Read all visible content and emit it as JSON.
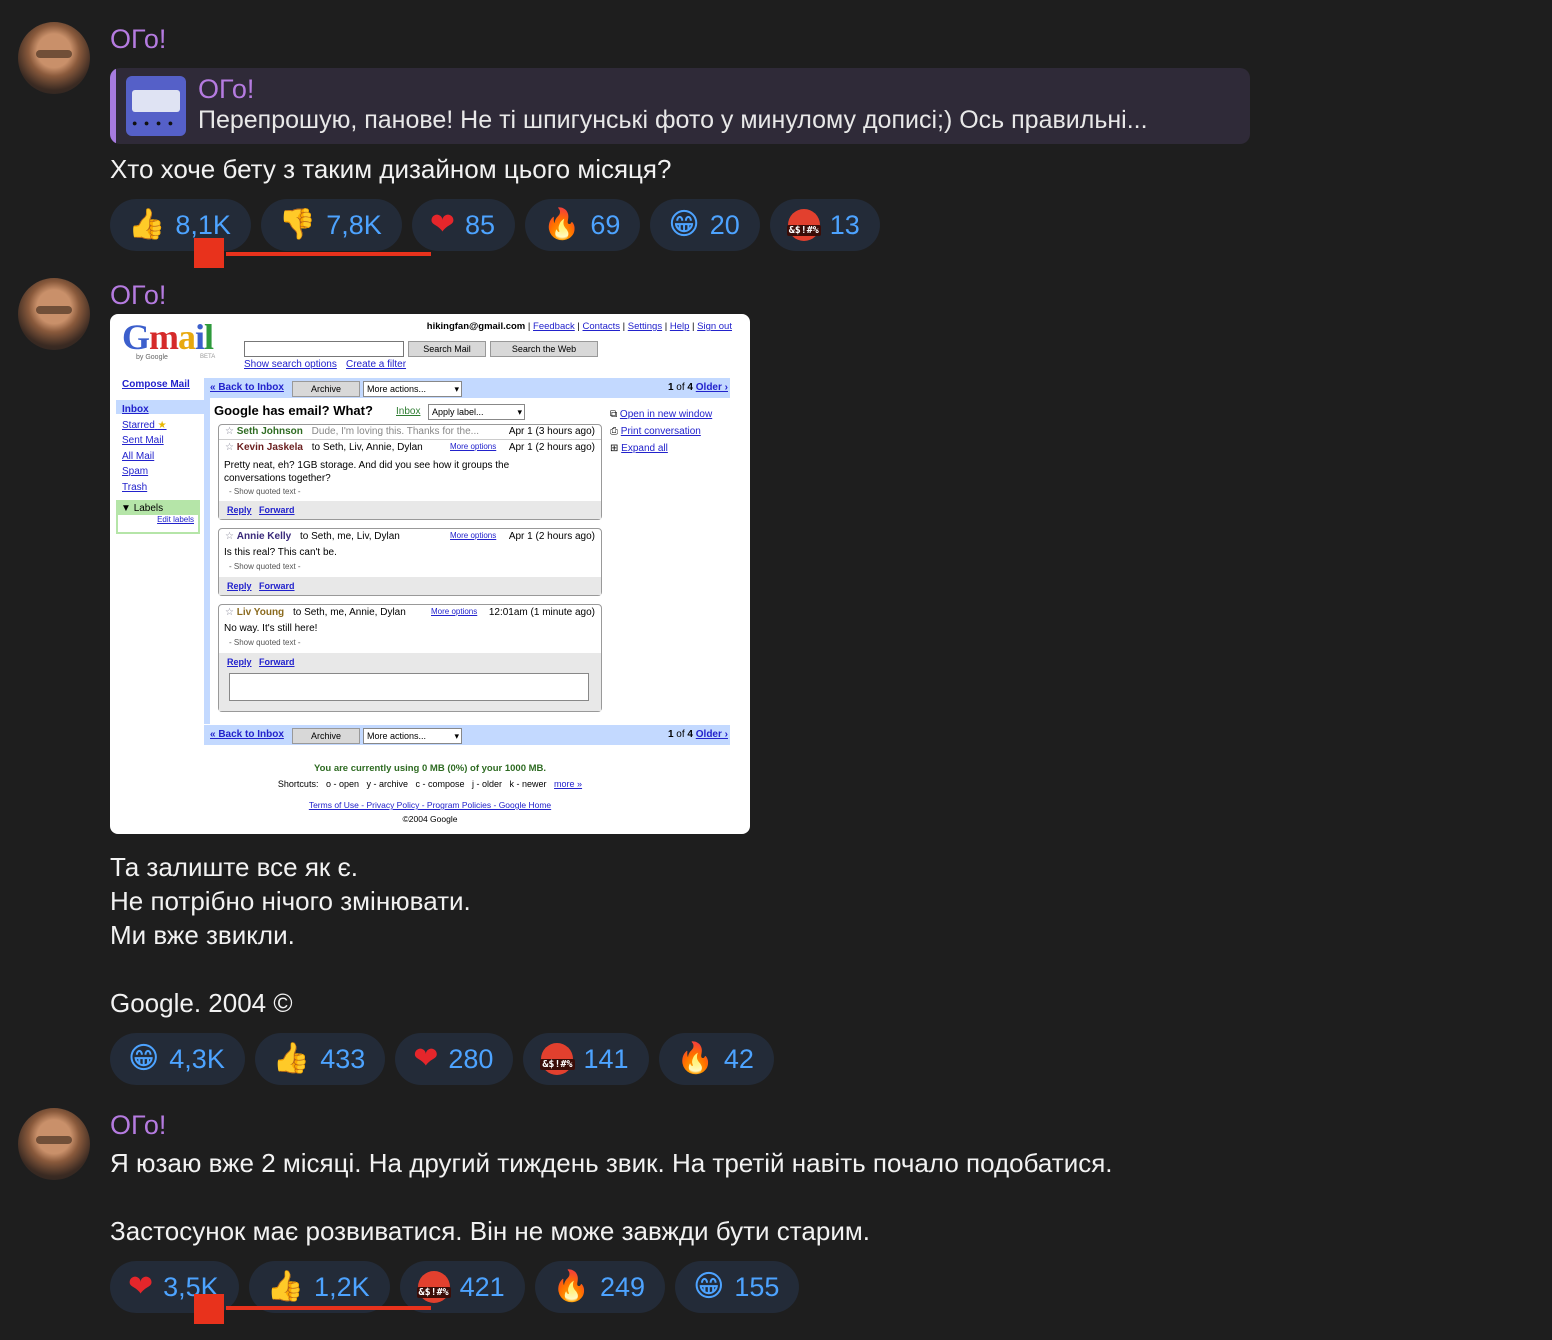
{
  "channel_name": "ОГо!",
  "messages": [
    {
      "author": "ОГо!",
      "reply": {
        "author": "ОГо!",
        "text": "Перепрошую, панове! Не ті шпигунські фото у минулому дописі;) Ось правильні..."
      },
      "text": "Хто хоче бету з таким дизайном цього місяця?",
      "reactions": [
        {
          "emoji": "👍",
          "count": "8,1K"
        },
        {
          "emoji": "👎",
          "count": "7,8K"
        },
        {
          "emoji": "❤",
          "count": "85"
        },
        {
          "emoji": "🔥",
          "count": "69"
        },
        {
          "emoji": "😁",
          "count": "20"
        },
        {
          "emoji": "🤬",
          "emoji_text": "&$!#%",
          "count": "13"
        }
      ]
    },
    {
      "author": "ОГо!",
      "image": {
        "logo": "Gmail",
        "by_google": "by Google",
        "beta": "BETA",
        "account": "hikingfan@gmail.com",
        "top_links": [
          "Feedback",
          "Contacts",
          "Settings",
          "Help",
          "Sign out"
        ],
        "search_mail": "Search Mail",
        "search_web": "Search the Web",
        "show_search_options": "Show search options",
        "create_filter": "Create a filter",
        "compose": "Compose Mail",
        "nav": [
          "Inbox",
          "Starred",
          "Sent Mail",
          "All Mail",
          "Spam",
          "Trash"
        ],
        "labels": "Labels",
        "edit_labels": "Edit labels",
        "back_to_inbox": "« Back to Inbox",
        "archive": "Archive",
        "more_actions": "More actions...",
        "pager_prefix": "1",
        "pager_of": "of",
        "pager_total": "4",
        "older": "Older ›",
        "subject": "Google has email? What?",
        "inbox_label": "Inbox",
        "apply_label": "Apply label...",
        "side_actions": [
          "Open in new window",
          "Print conversation",
          "Expand all"
        ],
        "emails": [
          {
            "from": "Seth Johnson",
            "snippet": "Dude, I'm loving this. Thanks for the...",
            "date": "Apr 1 (3 hours ago)"
          },
          {
            "from": "Kevin Jaskela",
            "to": "to Seth, Liv, Annie, Dylan",
            "more": "More options",
            "date": "Apr 1 (2 hours ago)",
            "body": "Pretty neat, eh? 1GB storage. And did you see how it groups the conversations together?",
            "quoted": "- Show quoted text -"
          },
          {
            "from": "Annie Kelly",
            "to": "to Seth, me, Liv, Dylan",
            "more": "More options",
            "date": "Apr 1 (2 hours ago)",
            "body": "Is this real? This can't be.",
            "quoted": "- Show quoted text -"
          },
          {
            "from": "Liv Young",
            "to": "to Seth, me, Annie, Dylan",
            "more": "More options",
            "date": "12:01am (1 minute ago)",
            "body": "No way. It's still here!",
            "quoted": "- Show quoted text -"
          }
        ],
        "reply": "Reply",
        "forward": "Forward",
        "usage": "You are currently using 0 MB (0%) of your 1000 MB.",
        "shortcuts": "Shortcuts:   o - open   y - archive   c - compose   j - older   k - newer",
        "more_link": "more »",
        "footer_links": "Terms of Use - Privacy Policy - Program Policies - Google Home",
        "copyright": "©2004 Google"
      },
      "text": "Та залиште все як є.\nНе потрібно нічого змінювати.\nМи вже звикли.\n\nGoogle. 2004 ©",
      "reactions": [
        {
          "emoji": "😁",
          "count": "4,3K"
        },
        {
          "emoji": "👍",
          "count": "433"
        },
        {
          "emoji": "❤",
          "count": "280"
        },
        {
          "emoji": "🤬",
          "emoji_text": "&$!#%",
          "count": "141"
        },
        {
          "emoji": "🔥",
          "count": "42"
        }
      ]
    },
    {
      "author": "ОГо!",
      "text": "Я юзаю вже 2 місяці. На другий тиждень звик. На третій навіть почало подобатися.\n\nЗастосунок має розвиватися. Він не може завжди бути старим.",
      "reactions": [
        {
          "emoji": "❤",
          "count": "3,5K"
        },
        {
          "emoji": "👍",
          "count": "1,2K"
        },
        {
          "emoji": "🤬",
          "emoji_text": "&$!#%",
          "count": "421"
        },
        {
          "emoji": "🔥",
          "count": "249"
        },
        {
          "emoji": "😁",
          "count": "155"
        }
      ]
    }
  ],
  "colors": {
    "background": "#1e1e1e",
    "author": "#b57be0",
    "reaction_bg": "#232b38",
    "reaction_count": "#4da3ff",
    "annotation": "#e8321c"
  }
}
